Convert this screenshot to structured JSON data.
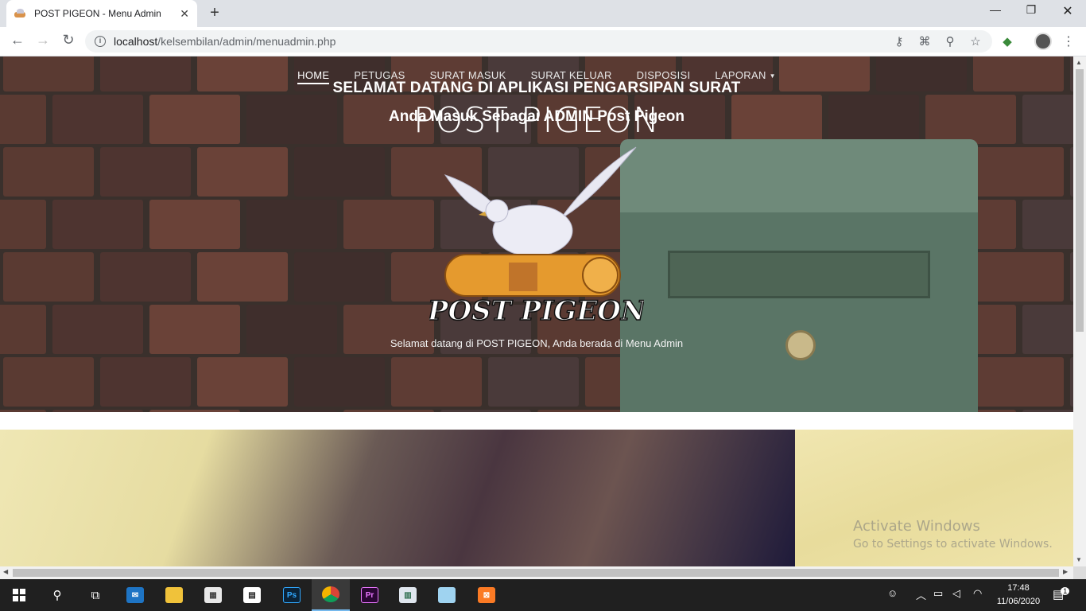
{
  "browser": {
    "tab_title": "POST PIGEON - Menu Admin",
    "tab_close": "✕",
    "new_tab": "+",
    "url_host": "localhost",
    "url_path": "/kelsembilan/admin/menuadmin.php",
    "window_controls": {
      "minimize": "—",
      "restore": "❐",
      "close": "✕"
    },
    "nav": {
      "back": "←",
      "forward": "→",
      "reload": "↻"
    },
    "toolbar_icons": [
      "key-icon",
      "translate-icon",
      "zoom-icon",
      "star-icon",
      "extension-icon",
      "profile-icon",
      "menu-icon"
    ]
  },
  "site": {
    "nav_items": [
      {
        "label": "HOME",
        "active": true
      },
      {
        "label": "PETUGAS",
        "active": false
      },
      {
        "label": "SURAT MASUK",
        "active": false
      },
      {
        "label": "SURAT KELUAR",
        "active": false
      },
      {
        "label": "DISPOSISI",
        "active": false
      },
      {
        "label": "LAPORAN",
        "active": false,
        "dropdown": true
      }
    ],
    "hero_title": "POST PIGEON",
    "logo_text": "POST PIGEON",
    "welcome_text": "Selamat datang di POST PIGEON, Anda berada di Menu Admin",
    "section_heading": "SELAMAT DATANG DI APLIKASI PENGARSIPAN SURAT",
    "section_subheading": "Anda Masuk Sebagai ADMIN Post Pigeon"
  },
  "watermark": {
    "line1": "Activate Windows",
    "line2": "Go to Settings to activate Windows."
  },
  "taskbar": {
    "apps": [
      "start-icon",
      "search-icon",
      "task-view-icon",
      "mail-icon",
      "file-explorer-icon",
      "store-icon",
      "video-editor-icon",
      "photoshop-icon",
      "chrome-icon",
      "premiere-icon",
      "app-icon",
      "notepad-icon",
      "xampp-icon"
    ],
    "time": "17:48",
    "date": "11/06/2020",
    "notification_count": "1"
  },
  "colors": {
    "accent": "#76b9ed",
    "taskbar": "#202020",
    "tabbar": "#dee1e6"
  }
}
